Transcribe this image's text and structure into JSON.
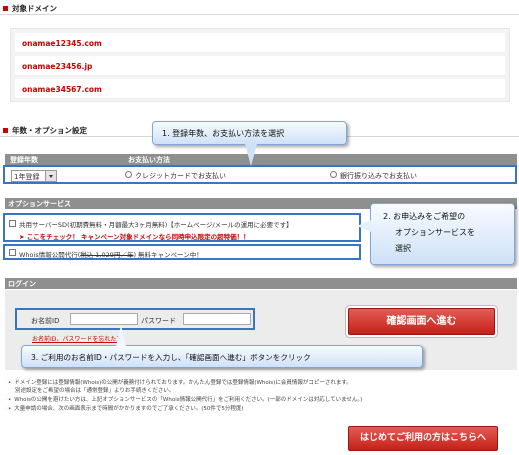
{
  "sections": {
    "target_domain_title": "対象ドメイン",
    "period_option_title": "年数・オプション設定",
    "option_service_header": "オプションサービス",
    "login_header": "ログイン"
  },
  "domains": [
    "onamae12345.com",
    "onamae23456.jp",
    "onamae34567.com"
  ],
  "period_table": {
    "col_period": "登録年数",
    "col_payment": "お支払い方法",
    "period_value": "1年登録",
    "payment_credit": "クレジットカードでお支払い",
    "payment_bank": "銀行振り込みでお支払い"
  },
  "options": {
    "shared_server": "共用サーバーSD(初期費無料・月額最大3ヶ月無料)【ホームページ/メールの運用に必要です】",
    "campaign_note": "ここをチェック！ キャンペーン対象ドメインなら同時申込限定の超特価！！",
    "whois_prefix": "Whois情報公開代行(",
    "whois_price": "税込 1,029円／年",
    "whois_suffix": ") 無料キャンペーン中！"
  },
  "login": {
    "id_label": "お名前ID",
    "password_label": "パスワード",
    "forgot_link": "お名前ID、パスワードを忘れた方",
    "confirm_button": "確認画面へ進む"
  },
  "notes": [
    "ドメイン登録には登録情報(Whois)の公開が義務付けられております。かんたん登録では登録情報(Whois)に会員情報がコピーされます。",
    "別途設定をご希望の場合は「通常登録」よりお手続きください。",
    "Whoisの公開を避けたい方は、上記オプションサービスの「Whois情報公開代行」をご利用ください。(一部のドメインは対応していません。)",
    "大量申請の場合、次の画面表示まで時間がかかりますのでご了承ください。(50件で5分程度)"
  ],
  "first_time_button": "はじめてご利用の方はこちらへ",
  "callouts": {
    "c1": "1. 登録年数、お支払い方法を選択",
    "c2_line1": "2. お申込みをご希望の",
    "c2_line2": "オプションサービスを",
    "c2_line3": "選択",
    "c3": "3. ご利用のお名前ID・パスワードを入力し、「確認画面へ進む」ボタンをクリック"
  },
  "colors": {
    "accent_red": "#c00000",
    "callout_border": "#3a75c4",
    "header_gray": "#8f8f8f"
  }
}
